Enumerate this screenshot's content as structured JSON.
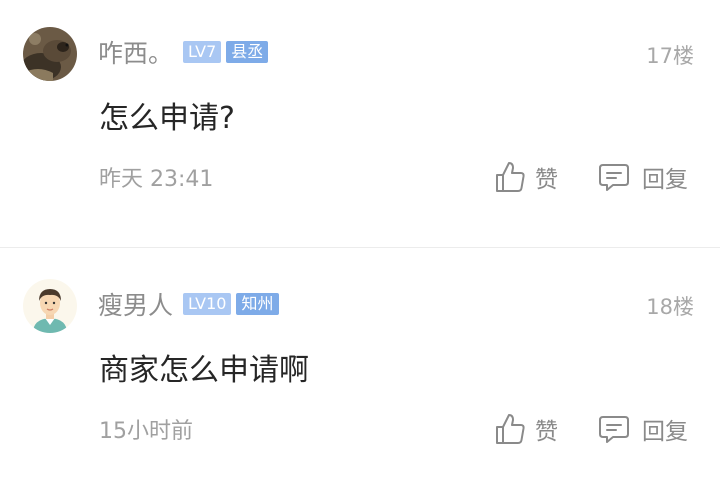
{
  "comments": [
    {
      "username": "咋西。",
      "level_badge": "LV7",
      "title_badge": "县丞",
      "floor": "17楼",
      "content": "怎么申请?",
      "time": "昨天 23:41",
      "like_label": "赞",
      "reply_label": "回复"
    },
    {
      "username": "瘦男人",
      "level_badge": "LV10",
      "title_badge": "知州",
      "floor": "18楼",
      "content": "商家怎么申请啊",
      "time": "15小时前",
      "like_label": "赞",
      "reply_label": "回复"
    }
  ],
  "colors": {
    "level_badge": "#a9c7f3",
    "title_badge": "#7eabe8",
    "username": "#8c8c8c",
    "content": "#262626",
    "meta": "#a0a0a0"
  },
  "icons": {
    "like": "thumbs-up-icon",
    "reply": "comment-bubble-icon"
  }
}
